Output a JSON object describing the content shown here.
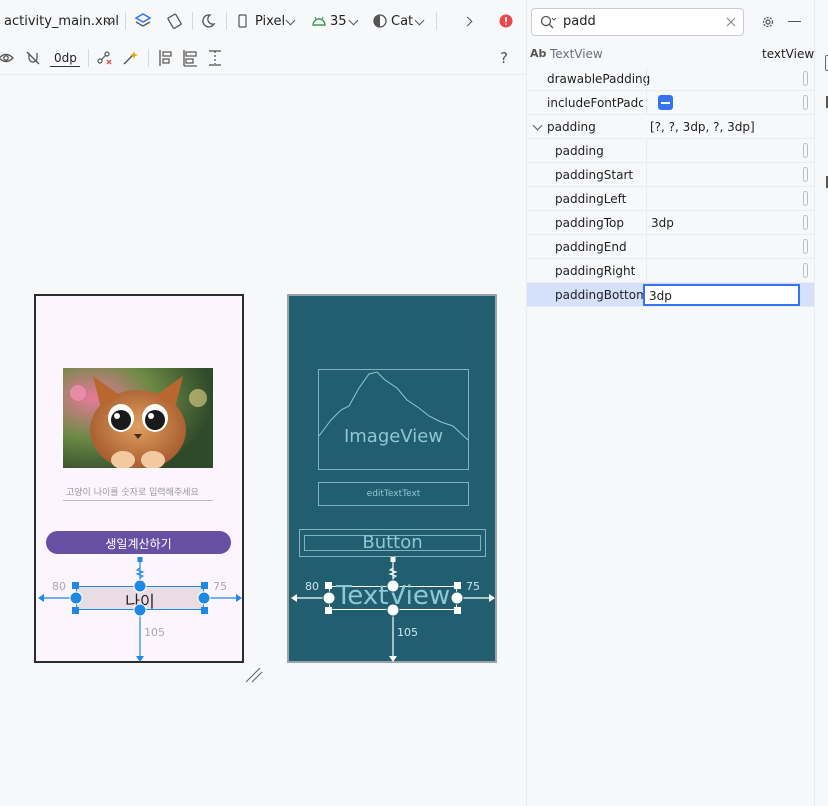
{
  "toolbar": {
    "file_name": "activity_main.xml",
    "device": "Pixel",
    "api_level": "35",
    "theme": "Cat",
    "margin_default": "0dp",
    "help": "?"
  },
  "search": {
    "value": "padd"
  },
  "attributes": {
    "component_type": "TextView",
    "component_id": "textView",
    "rows": [
      {
        "name": "drawablePadding",
        "value": ""
      },
      {
        "name": "includeFontPaddi…",
        "value": ""
      },
      {
        "name": "padding",
        "value": "[?, ?, 3dp, ?, 3dp]"
      },
      {
        "name": "padding",
        "value": ""
      },
      {
        "name": "paddingStart",
        "value": ""
      },
      {
        "name": "paddingLeft",
        "value": ""
      },
      {
        "name": "paddingTop",
        "value": "3dp"
      },
      {
        "name": "paddingEnd",
        "value": ""
      },
      {
        "name": "paddingRight",
        "value": ""
      },
      {
        "name": "paddingBottom",
        "value": "3dp"
      }
    ]
  },
  "design": {
    "edit_hint": "고양이 나이를 숫자로 입력해주세요",
    "button_label": "생일계산하기",
    "textview_text": "나이",
    "margin_left": "80",
    "margin_right": "75",
    "margin_bottom": "105"
  },
  "blueprint": {
    "image_label": "ImageView",
    "edit_label": "editTextText",
    "button_label": "Button",
    "textview_label": "TextView",
    "margin_left": "80",
    "margin_right": "75",
    "margin_bottom": "105"
  },
  "colors": {
    "accent": "#3574f0",
    "button_purple": "#6750a4",
    "blueprint_bg": "#215e70",
    "selection_blue": "#1e88e5"
  }
}
